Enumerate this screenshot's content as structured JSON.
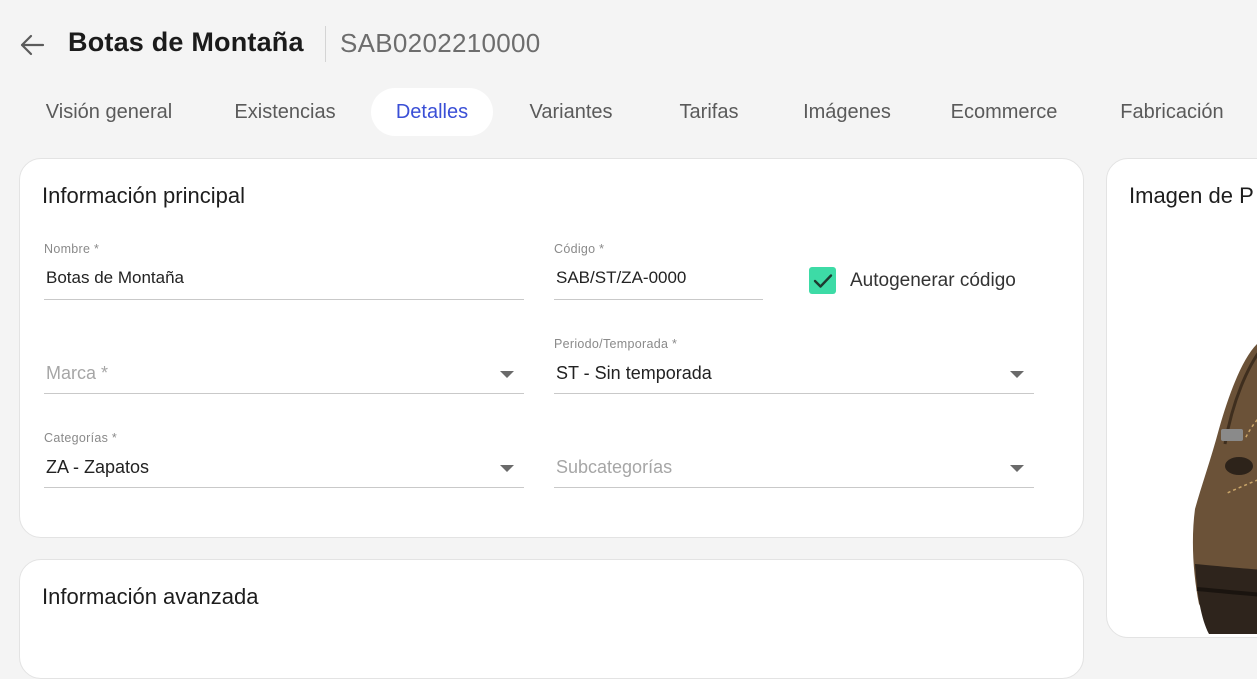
{
  "header": {
    "title": "Botas de Montaña",
    "code": "SAB0202210000"
  },
  "tabs": [
    {
      "label": "Visión general"
    },
    {
      "label": "Existencias"
    },
    {
      "label": "Detalles",
      "active": true
    },
    {
      "label": "Variantes"
    },
    {
      "label": "Tarifas"
    },
    {
      "label": "Imágenes"
    },
    {
      "label": "Ecommerce"
    },
    {
      "label": "Fabricación"
    }
  ],
  "main_info": {
    "title": "Información principal",
    "nombre": {
      "label": "Nombre *",
      "value": "Botas de Montaña"
    },
    "codigo": {
      "label": "Código *",
      "value": "SAB/ST/ZA-0000"
    },
    "autogenerar": {
      "label": "Autogenerar código",
      "checked": true
    },
    "marca": {
      "placeholder": "Marca *"
    },
    "periodo": {
      "label": "Periodo/Temporada *",
      "value": "ST - Sin temporada"
    },
    "categorias": {
      "label": "Categorías *",
      "value": "ZA - Zapatos"
    },
    "subcategorias": {
      "placeholder": "Subcategorías"
    }
  },
  "advanced_info": {
    "title": "Información avanzada"
  },
  "image_panel": {
    "title": "Imagen de P"
  },
  "colors": {
    "accent": "#3a4fd6",
    "checkbox": "#3ddba6"
  }
}
